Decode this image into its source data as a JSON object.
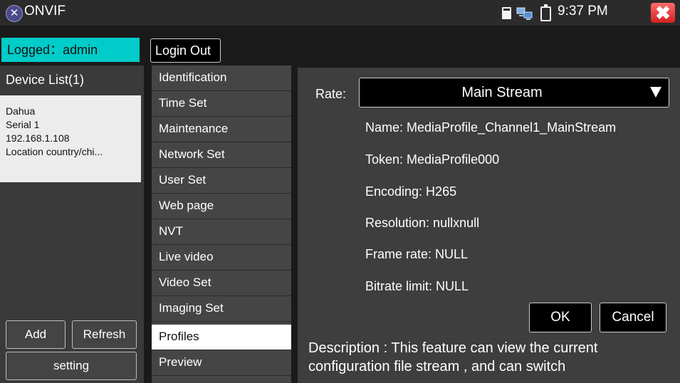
{
  "topbar": {
    "app_icon": "tools-icon",
    "app_icon_glyph": "✕",
    "app_title": "ONVIF",
    "time": "9:37 PM",
    "close_glyph": "✖"
  },
  "session": {
    "logged_label": "Logged：admin",
    "login_out_label": "Login Out"
  },
  "device_list": {
    "header": "Device List(1)",
    "device": {
      "name": "Dahua",
      "serial": "Serial 1",
      "ip": "192.168.1.108",
      "location": "Location country/chi..."
    },
    "add_label": "Add",
    "refresh_label": "Refresh",
    "setting_label": "setting"
  },
  "menu": {
    "items": [
      {
        "label": "Identification"
      },
      {
        "label": "Time Set"
      },
      {
        "label": "Maintenance"
      },
      {
        "label": "Network Set"
      },
      {
        "label": "User Set"
      },
      {
        "label": "Web page"
      },
      {
        "label": "NVT"
      },
      {
        "label": "Live video"
      },
      {
        "label": "Video Set"
      },
      {
        "label": "Imaging Set"
      },
      {
        "label": "Profiles"
      },
      {
        "label": "Preview"
      }
    ],
    "active": "Profiles"
  },
  "profile": {
    "rate_label": "Rate:",
    "rate_value": "Main Stream",
    "name": "Name:  MediaProfile_Channel1_MainStream",
    "token": "Token:  MediaProfile000",
    "encoding": "Encoding:  H265",
    "resolution": "Resolution:  nullxnull",
    "frame_rate": "Frame rate:  NULL",
    "bitrate_limit": "Bitrate limit:  NULL",
    "ok_label": "OK",
    "cancel_label": "Cancel",
    "description": "Description : This feature can view the current configuration file stream , and can switch"
  },
  "colors": {
    "accent": "#00ccc9",
    "close": "#e03030",
    "topbar": "#2b2b2b"
  }
}
